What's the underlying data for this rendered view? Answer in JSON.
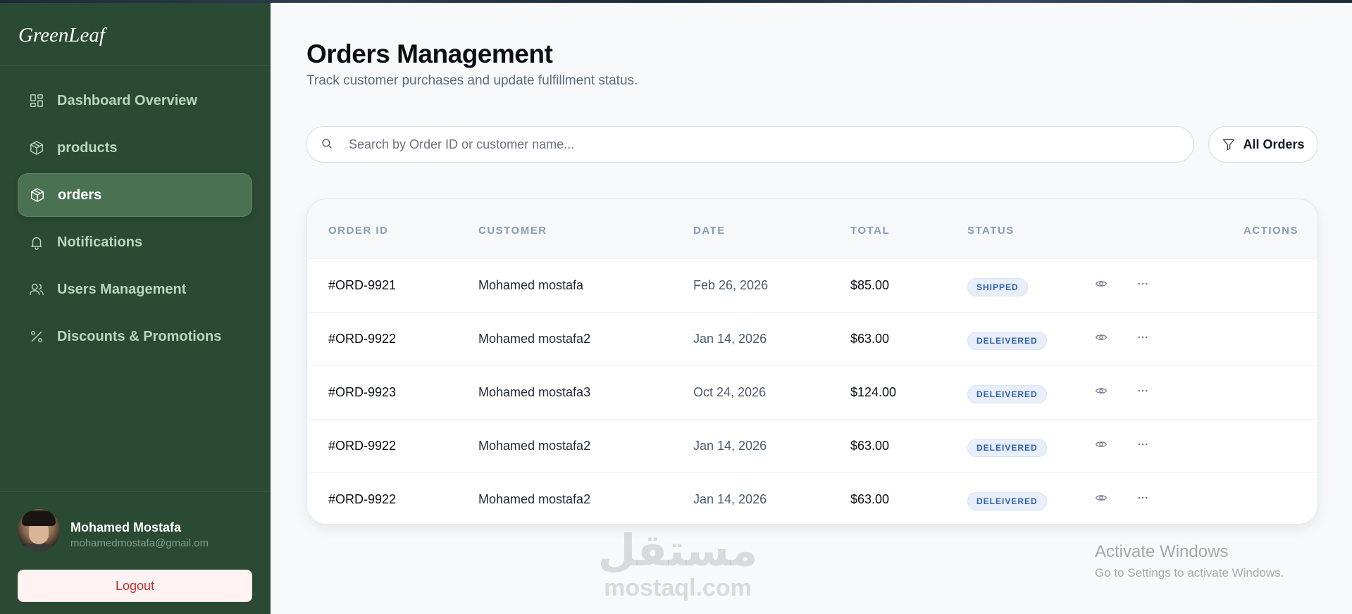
{
  "brand": {
    "name": "GreenLeaf"
  },
  "sidebar": {
    "items": [
      {
        "label": "Dashboard Overview",
        "icon": "grid-icon",
        "active": false
      },
      {
        "label": "products",
        "icon": "box-icon",
        "active": false
      },
      {
        "label": "orders",
        "icon": "box-icon",
        "active": true
      },
      {
        "label": "Notifications",
        "icon": "bell-icon",
        "active": false
      },
      {
        "label": "Users Management",
        "icon": "users-icon",
        "active": false
      },
      {
        "label": "Discounts & Promotions",
        "icon": "percent-icon",
        "active": false
      }
    ],
    "user": {
      "name": "Mohamed Mostafa",
      "email": "mohamedmostafa@gmail.om",
      "logout_label": "Logout"
    }
  },
  "header": {
    "title": "Orders Management",
    "subtitle": "Track customer purchases and update fulfillment status."
  },
  "search": {
    "placeholder": "Search by Order ID or customer name...",
    "value": ""
  },
  "filter": {
    "label": "All Orders"
  },
  "table": {
    "columns": [
      "ORDER ID",
      "CUSTOMER",
      "DATE",
      "TOTAL",
      "STATUS",
      "ACTIONS"
    ],
    "rows": [
      {
        "id": "#ORD-9921",
        "customer": "Mohamed mostafa",
        "date": "Feb 26, 2026",
        "total": "$85.00",
        "status": "SHIPPED"
      },
      {
        "id": "#ORD-9922",
        "customer": "Mohamed mostafa2",
        "date": "Jan 14, 2026",
        "total": "$63.00",
        "status": "DELEIVERED"
      },
      {
        "id": "#ORD-9923",
        "customer": "Mohamed mostafa3",
        "date": "Oct 24, 2026",
        "total": "$124.00",
        "status": "DELEIVERED"
      },
      {
        "id": "#ORD-9922",
        "customer": "Mohamed mostafa2",
        "date": "Jan 14, 2026",
        "total": "$63.00",
        "status": "DELEIVERED"
      },
      {
        "id": "#ORD-9922",
        "customer": "Mohamed mostafa2",
        "date": "Jan 14, 2026",
        "total": "$63.00",
        "status": "DELEIVERED"
      }
    ]
  },
  "watermark": {
    "arabic": "مستقل",
    "latin": "mostaql.com"
  },
  "os_overlay": {
    "title": "Activate Windows",
    "message": "Go to Settings to activate Windows."
  },
  "colors": {
    "sidebar_bg": "#2a4a33",
    "sidebar_active": "#4a7252",
    "badge_text": "#2f5fb3",
    "logout_text": "#c62828"
  }
}
